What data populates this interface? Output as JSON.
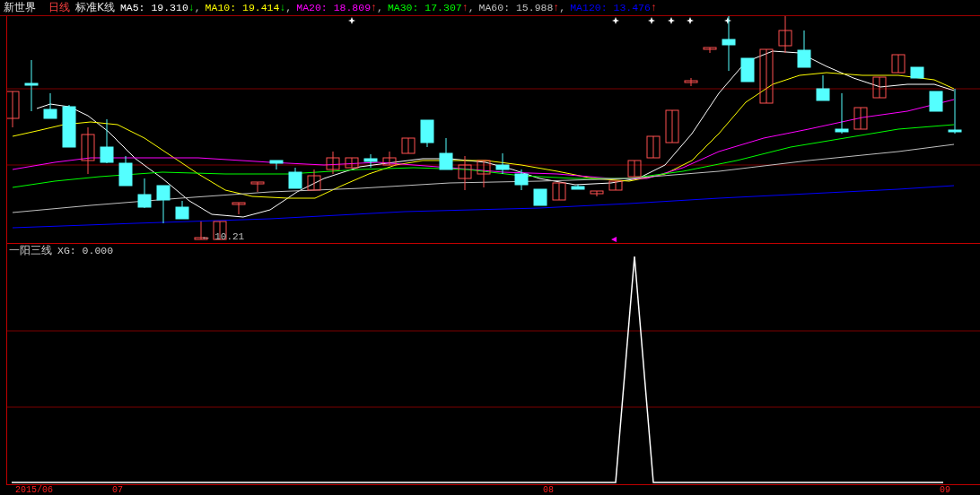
{
  "header": {
    "stock": "新世界",
    "period": "日线",
    "chart_type": "标准K线"
  },
  "ma": [
    {
      "reading": "MA5: 19.310",
      "arrow": "↓",
      "kind": "down",
      "color": "#ffffff",
      "separator": ","
    },
    {
      "reading": "MA10: 19.414",
      "arrow": "↓",
      "kind": "down",
      "color": "#ffff00",
      "separator": ","
    },
    {
      "reading": "MA20: 18.809",
      "arrow": "↑",
      "kind": "up",
      "color": "#ff00ff",
      "separator": ","
    },
    {
      "reading": "MA30: 17.307",
      "arrow": "↑",
      "kind": "up",
      "color": "#00ff00",
      "separator": ","
    },
    {
      "reading": "MA60: 15.988",
      "arrow": "↑",
      "kind": "up",
      "color": "#c0c0c0",
      "separator": ","
    },
    {
      "reading": "MA120: 13.476",
      "arrow": "↑",
      "kind": "up",
      "color": "#0000ff"
    }
  ],
  "low_marker": {
    "arrow": "←",
    "value": "10.21"
  },
  "indicator": {
    "name": "一阳三线",
    "reading": "XG: 0.000"
  },
  "axis_labels": [
    "2015/06",
    "07",
    "08",
    "09"
  ]
}
